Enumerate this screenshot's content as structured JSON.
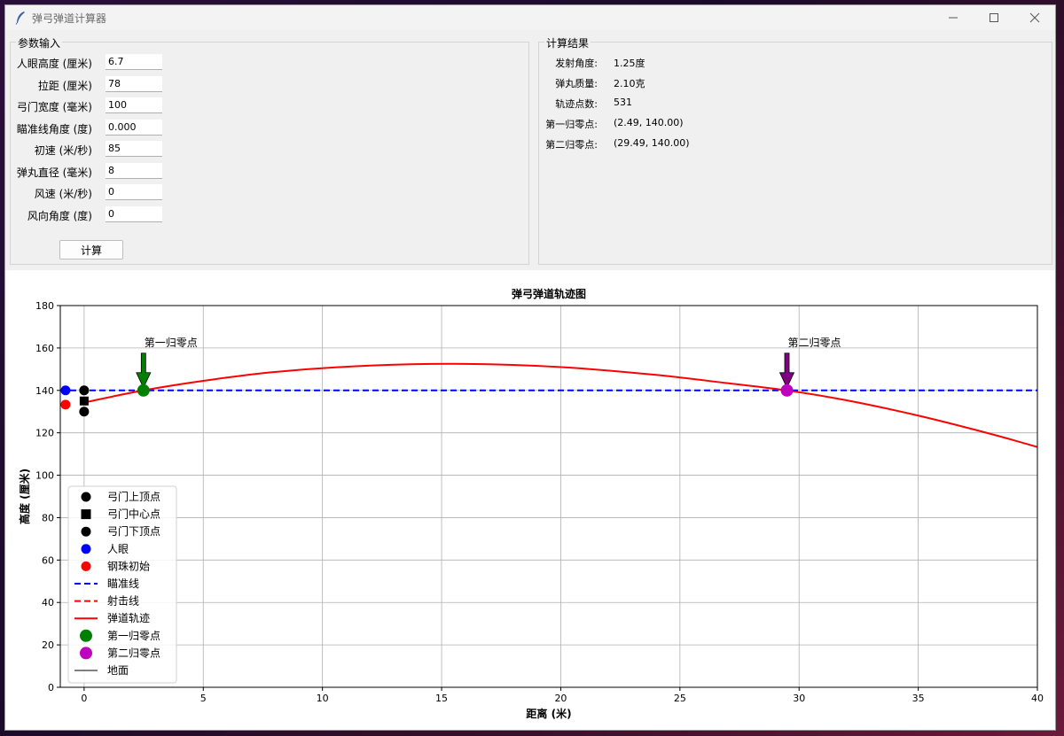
{
  "window": {
    "title": "弹弓弹道计算器"
  },
  "params": {
    "title": "参数输入",
    "fields": [
      {
        "label": "人眼高度 (厘米)",
        "value": "6.7"
      },
      {
        "label": "拉距 (厘米)",
        "value": "78"
      },
      {
        "label": "弓门宽度 (毫米)",
        "value": "100"
      },
      {
        "label": "瞄准线角度 (度)",
        "value": "0.000"
      },
      {
        "label": "初速 (米/秒)",
        "value": "85"
      },
      {
        "label": "弹丸直径 (毫米)",
        "value": "8"
      },
      {
        "label": "风速 (米/秒)",
        "value": "0"
      },
      {
        "label": "风向角度 (度)",
        "value": "0"
      }
    ],
    "calc_button": "计算"
  },
  "results": {
    "title": "计算结果",
    "rows": [
      {
        "label": "发射角度:",
        "value": "1.25度"
      },
      {
        "label": "弹丸质量:",
        "value": "2.10克"
      },
      {
        "label": "轨迹点数:",
        "value": "531"
      },
      {
        "label": "第一归零点:",
        "value": "(2.49, 140.00)"
      },
      {
        "label": "第二归零点:",
        "value": "(29.49, 140.00)"
      }
    ]
  },
  "chart_data": {
    "type": "line",
    "title": "弹弓弹道轨迹图",
    "xlabel": "距离 (米)",
    "ylabel": "高度 (厘米)",
    "xlim": [
      -1,
      40
    ],
    "ylim": [
      0,
      180
    ],
    "xticks": [
      0,
      5,
      10,
      15,
      20,
      25,
      30,
      35,
      40
    ],
    "yticks": [
      0,
      20,
      40,
      60,
      80,
      100,
      120,
      140,
      160,
      180
    ],
    "grid": true,
    "legend_position": "lower-left",
    "colors": {
      "sight": "#0000ff",
      "shot": "#ff0000",
      "trajectory": "#ff0000",
      "zero1": "#008000",
      "zero2": "#bf00bf",
      "arrow1": "#008000",
      "arrow2": "#800080"
    },
    "sight_line_y": 140,
    "trajectory": {
      "x": [
        0,
        2.49,
        5,
        8,
        12,
        15.99,
        20,
        24,
        27,
        29.49,
        32,
        35,
        38,
        40
      ],
      "y": [
        134.3,
        140,
        144.5,
        148.7,
        151.7,
        152.5,
        151.0,
        147.3,
        143.4,
        140,
        135.3,
        128.1,
        119.6,
        113.3
      ]
    },
    "markers": [
      {
        "name": "弓门上顶点",
        "x": 0,
        "y": 140,
        "shape": "circle",
        "color": "#000000"
      },
      {
        "name": "弓门中心点",
        "x": 0,
        "y": 135,
        "shape": "square",
        "color": "#000000"
      },
      {
        "name": "弓门下顶点",
        "x": 0,
        "y": 130,
        "shape": "circle",
        "color": "#000000"
      },
      {
        "name": "人眼",
        "x": -0.78,
        "y": 140,
        "shape": "circle",
        "color": "#0000ff"
      },
      {
        "name": "钢珠初始",
        "x": -0.78,
        "y": 133.3,
        "shape": "circle",
        "color": "#ff0000"
      }
    ],
    "zero_points": [
      {
        "name": "第一归零点",
        "x": 2.49,
        "y": 140,
        "color": "#008000",
        "annotation": "第一归零点"
      },
      {
        "name": "第二归零点",
        "x": 29.49,
        "y": 140,
        "color": "#bf00bf",
        "annotation": "第二归零点"
      }
    ],
    "legend": [
      {
        "label": "弓门上顶点",
        "kind": "circle",
        "color": "#000000"
      },
      {
        "label": "弓门中心点",
        "kind": "square",
        "color": "#000000"
      },
      {
        "label": "弓门下顶点",
        "kind": "circle",
        "color": "#000000"
      },
      {
        "label": "人眼",
        "kind": "circle",
        "color": "#0000ff"
      },
      {
        "label": "钢珠初始",
        "kind": "circle",
        "color": "#ff0000"
      },
      {
        "label": "瞄准线",
        "kind": "dash",
        "color": "#0000ff"
      },
      {
        "label": "射击线",
        "kind": "dash",
        "color": "#ff0000"
      },
      {
        "label": "弹道轨迹",
        "kind": "line",
        "color": "#ff0000"
      },
      {
        "label": "第一归零点",
        "kind": "bigcircle",
        "color": "#008000"
      },
      {
        "label": "第二归零点",
        "kind": "bigcircle",
        "color": "#bf00bf"
      },
      {
        "label": "地面",
        "kind": "thinline",
        "color": "#000000"
      }
    ]
  }
}
